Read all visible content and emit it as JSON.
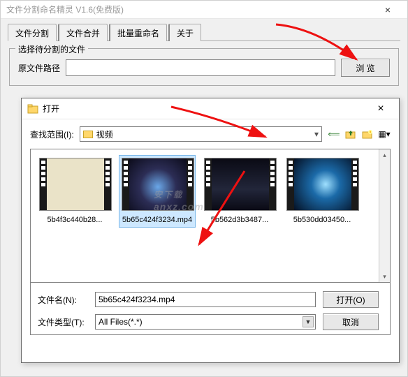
{
  "main": {
    "title": "文件分割命名精灵 V1.6(免费版)",
    "close": "×"
  },
  "tabs": {
    "items": [
      {
        "label": "文件分割"
      },
      {
        "label": "文件合并"
      },
      {
        "label": "批量重命名"
      },
      {
        "label": "关于"
      }
    ]
  },
  "groupbox": {
    "legend": "选择待分割的文件",
    "path_label": "原文件路径",
    "path_value": "",
    "browse": "浏 览"
  },
  "dialog": {
    "title": "打开",
    "close": "×",
    "lookin_label": "查找范围(I):",
    "lookin_value": "视频",
    "toolbar": {
      "back": "⟸",
      "up": "📂",
      "newfolder": "📁",
      "view": "▦"
    },
    "files": [
      {
        "name": "5b4f3c440b28..."
      },
      {
        "name": "5b65c424f3234.mp4"
      },
      {
        "name": "5b562d3b3487..."
      },
      {
        "name": "5b530dd03450..."
      }
    ],
    "filename_label": "文件名(N):",
    "filename_value": "5b65c424f3234.mp4",
    "filetype_label": "文件类型(T):",
    "filetype_value": "All Files(*.*)",
    "open_btn": "打开(O)",
    "cancel_btn": "取消"
  },
  "watermark": {
    "main": "安下载",
    "sub": "anxz.com"
  }
}
